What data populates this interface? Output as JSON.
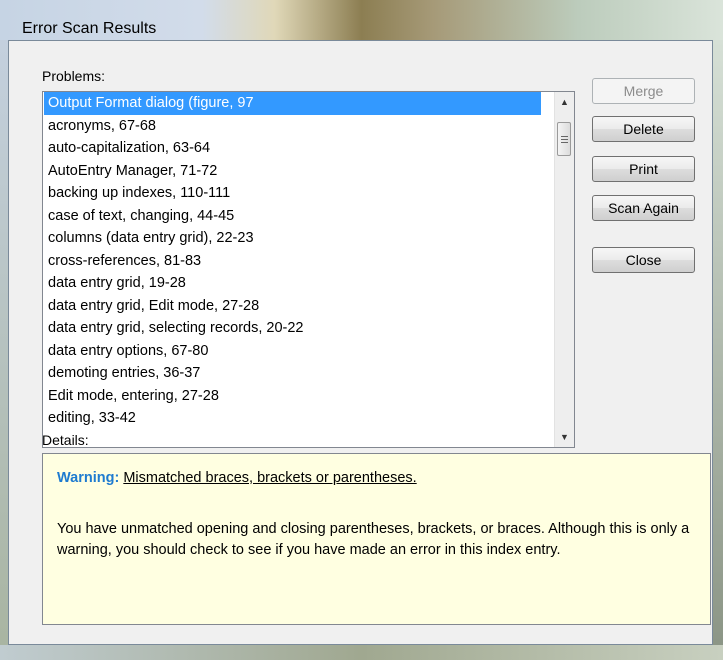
{
  "window": {
    "title": "Error Scan Results"
  },
  "problems": {
    "label": "Problems:",
    "items": [
      "Output Format dialog (figure, 97",
      "acronyms, 67-68",
      "auto-capitalization, 63-64",
      "AutoEntry Manager, 71-72",
      "backing up indexes, 110-111",
      "case of text, changing, 44-45",
      "columns (data entry grid), 22-23",
      "cross-references, 81-83",
      "data entry grid, 19-28",
      "data entry grid, Edit mode, 27-28",
      "data entry grid, selecting records, 20-22",
      "data entry options, 67-80",
      "demoting entries, 36-37",
      "Edit mode, entering, 27-28",
      "editing, 33-42"
    ],
    "selected_index": 0
  },
  "buttons": {
    "merge": "Merge",
    "delete": "Delete",
    "print": "Print",
    "scan_again": "Scan Again",
    "close": "Close"
  },
  "details": {
    "label": "Details:",
    "warning_heading": "Warning:",
    "warning_message": "Mismatched braces, brackets or parentheses.",
    "body": "You have unmatched opening and closing parentheses, brackets, or braces. Although this is only a warning, you should check to see if you have made an error in this index entry."
  },
  "icons": {
    "scroll_up": "scroll-up-arrow-icon",
    "scroll_down": "scroll-down-arrow-icon"
  },
  "colors": {
    "selection": "#3399ff",
    "warning_heading": "#1e7bd0",
    "details_background": "#ffffe1"
  }
}
